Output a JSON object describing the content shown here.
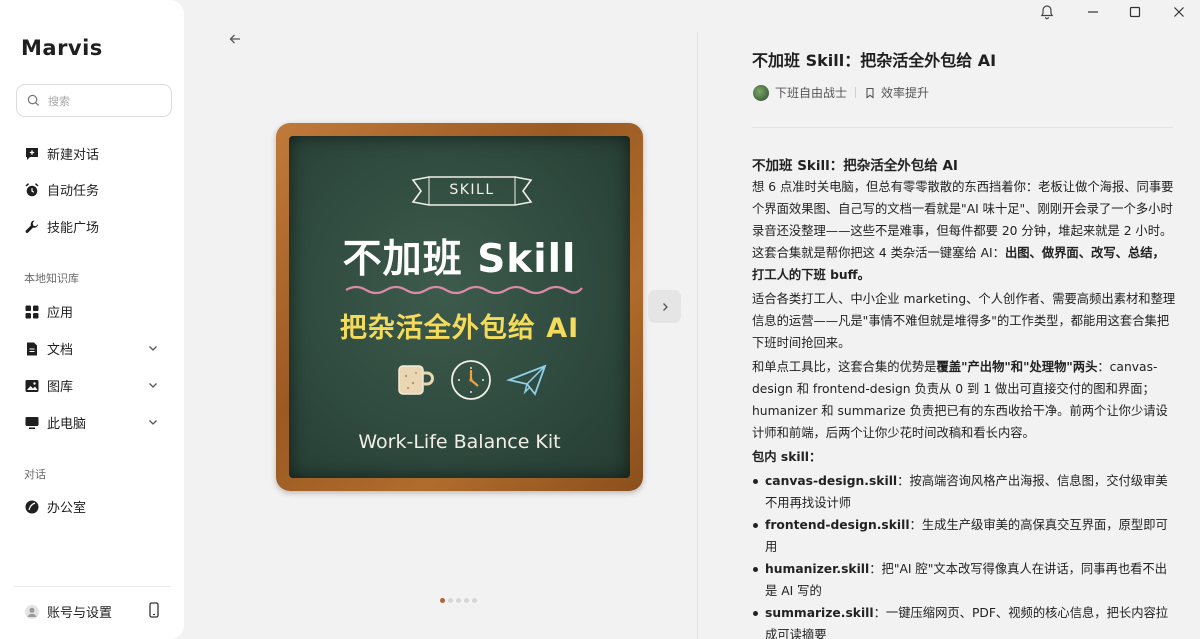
{
  "app": {
    "name": "Marvis"
  },
  "sidebar": {
    "search_placeholder": "搜索",
    "top_items": [
      {
        "label": "新建对话",
        "icon": "chat-plus-icon"
      },
      {
        "label": "自动任务",
        "icon": "alarm-clock-icon"
      },
      {
        "label": "技能广场",
        "icon": "wrench-icon"
      }
    ],
    "kb_section": "本地知识库",
    "kb_items": [
      {
        "label": "应用",
        "icon": "apps-grid-icon"
      },
      {
        "label": "文档",
        "icon": "document-icon"
      },
      {
        "label": "图库",
        "icon": "image-icon"
      },
      {
        "label": "此电脑",
        "icon": "monitor-icon"
      }
    ],
    "chat_section": "对话",
    "chat_items": [
      {
        "label": "办公室",
        "icon": "leaf-icon"
      }
    ],
    "account_label": "账号与设置"
  },
  "board": {
    "banner": "SKILL",
    "title": "不加班 Skill",
    "subtitle": "把杂活全外包给 AI",
    "footer": "Work-Life Balance Kit"
  },
  "carousel": {
    "count": 5,
    "active": 0
  },
  "article": {
    "title": "不加班 Skill：把杂活全外包给 AI",
    "author": "下班自由战士",
    "category": "效率提升",
    "heading": "不加班 Skill：把杂活全外包给 AI",
    "p1": "想 6 点准时关电脑，但总有零零散散的东西挡着你：老板让做个海报、同事要个界面效果图、自己写的文档一看就是\"AI 味十足\"、刚刚开会录了一个多小时录音还没整理——这些不是难事，但每件都要 20 分钟，堆起来就是 2 小时。这套合集就是帮你把这 4 类杂活一键塞给 AI：",
    "p1_bold": "出图、做界面、改写、总结，打工人的下班 buff。",
    "p2": "适合各类打工人、中小企业 marketing、个人创作者、需要高频出素材和整理信息的运营——凡是\"事情不难但就是堆得多\"的工作类型，都能用这套合集把下班时间抢回来。",
    "p3_a": "和单点工具比，这套合集的优势是",
    "p3_bold": "覆盖\"产出物\"和\"处理物\"两头",
    "p3_b": "：canvas-design 和 frontend-design 负责从 0 到 1 做出可直接交付的图和界面；humanizer 和 summarize 负责把已有的东西收拾干净。前两个让你少请设计师和前端，后两个让你少花时间改稿和看长内容。",
    "list_heading": "包内 skill：",
    "skills": [
      {
        "name": "canvas-design.skill",
        "desc": "：按高端咨询风格产出海报、信息图，交付级审美不用再找设计师"
      },
      {
        "name": "frontend-design.skill",
        "desc": "：生成生产级审美的高保真交互界面，原型即可用"
      },
      {
        "name": "humanizer.skill",
        "desc": "：把\"AI 腔\"文本改写得像真人在讲话，同事再也看不出是 AI 写的"
      },
      {
        "name": "summarize.skill",
        "desc": "：一键压缩网页、PDF、视频的核心信息，把长内容拉成可读摘要"
      }
    ]
  },
  "colors": {
    "accent": "#b2633a",
    "chalk_yellow": "#f5db5b",
    "board_green": "#2f4a3e",
    "frame_wood": "#a8642a"
  }
}
